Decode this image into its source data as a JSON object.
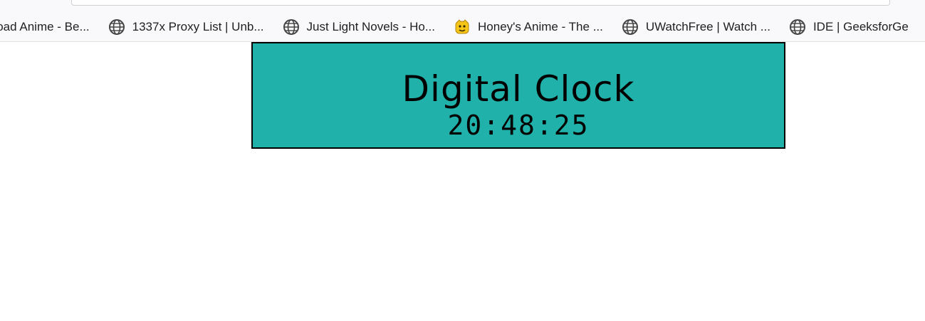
{
  "bookmarks": [
    {
      "label": "nload Anime - Be...",
      "icon": "globe-icon"
    },
    {
      "label": "1337x Proxy List | Unb...",
      "icon": "globe-icon"
    },
    {
      "label": "Just Light Novels - Ho...",
      "icon": "globe-icon"
    },
    {
      "label": "Honey's Anime - The ...",
      "icon": "emoji-face-icon"
    },
    {
      "label": "UWatchFree | Watch ...",
      "icon": "globe-icon"
    },
    {
      "label": "IDE | GeeksforGe",
      "icon": "globe-icon"
    }
  ],
  "clock": {
    "title": "Digital Clock",
    "time": "20:48:25",
    "background_color": "#20b2aa",
    "border_color": "#000000"
  }
}
